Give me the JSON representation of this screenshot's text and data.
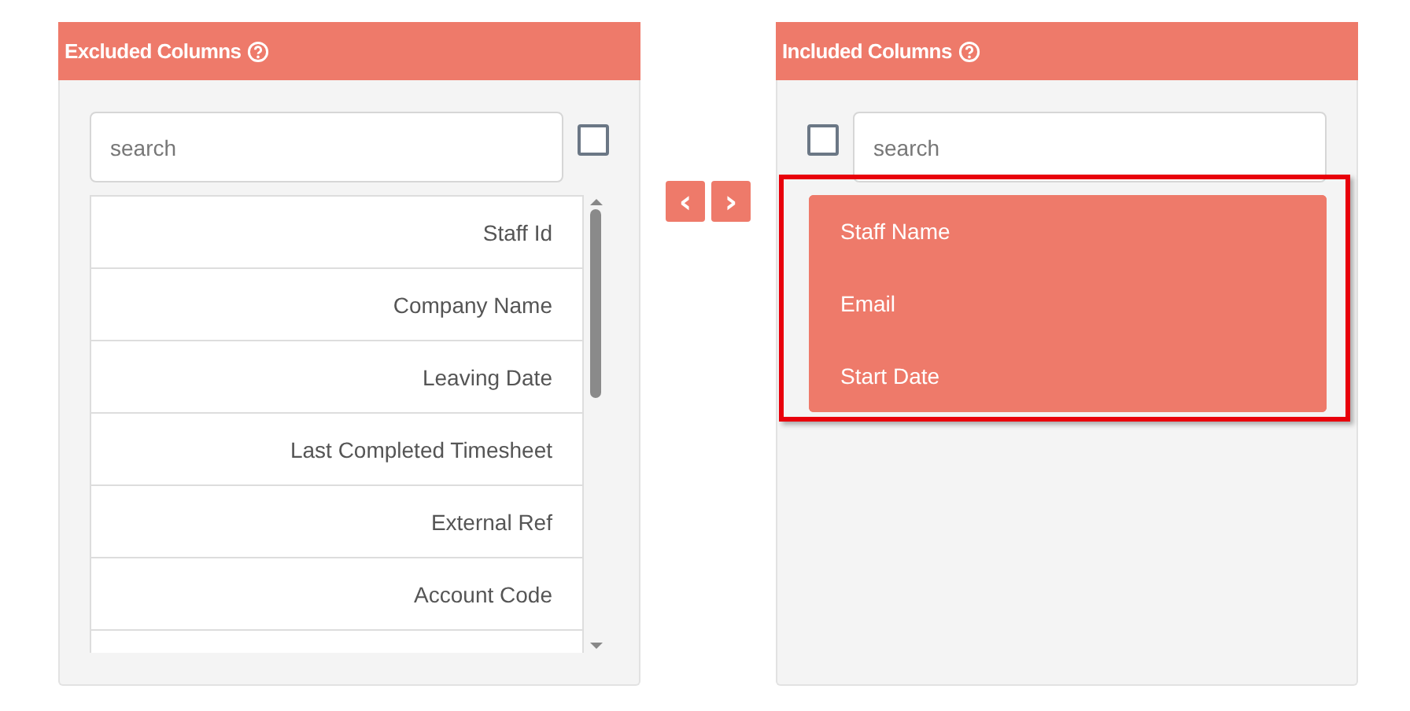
{
  "excluded": {
    "title": "Excluded Columns",
    "search": {
      "placeholder": "search"
    },
    "select_all": {
      "checked": false
    },
    "items": [
      {
        "label": "Staff Id",
        "selected": false
      },
      {
        "label": "Company Name",
        "selected": false
      },
      {
        "label": "Leaving Date",
        "selected": false
      },
      {
        "label": "Last Completed Timesheet",
        "selected": false
      },
      {
        "label": "External Ref",
        "selected": false
      },
      {
        "label": "Account Code",
        "selected": false
      }
    ]
  },
  "move_buttons": [
    "‹",
    "›"
  ],
  "included": {
    "title": "Included Columns",
    "search": {
      "placeholder": "search"
    },
    "select_all": {
      "checked": false
    },
    "highlighted": true,
    "items": [
      {
        "label": "Staff Name",
        "selected": true
      },
      {
        "label": "Email",
        "selected": true
      },
      {
        "label": "Start Date",
        "selected": true
      }
    ]
  }
}
